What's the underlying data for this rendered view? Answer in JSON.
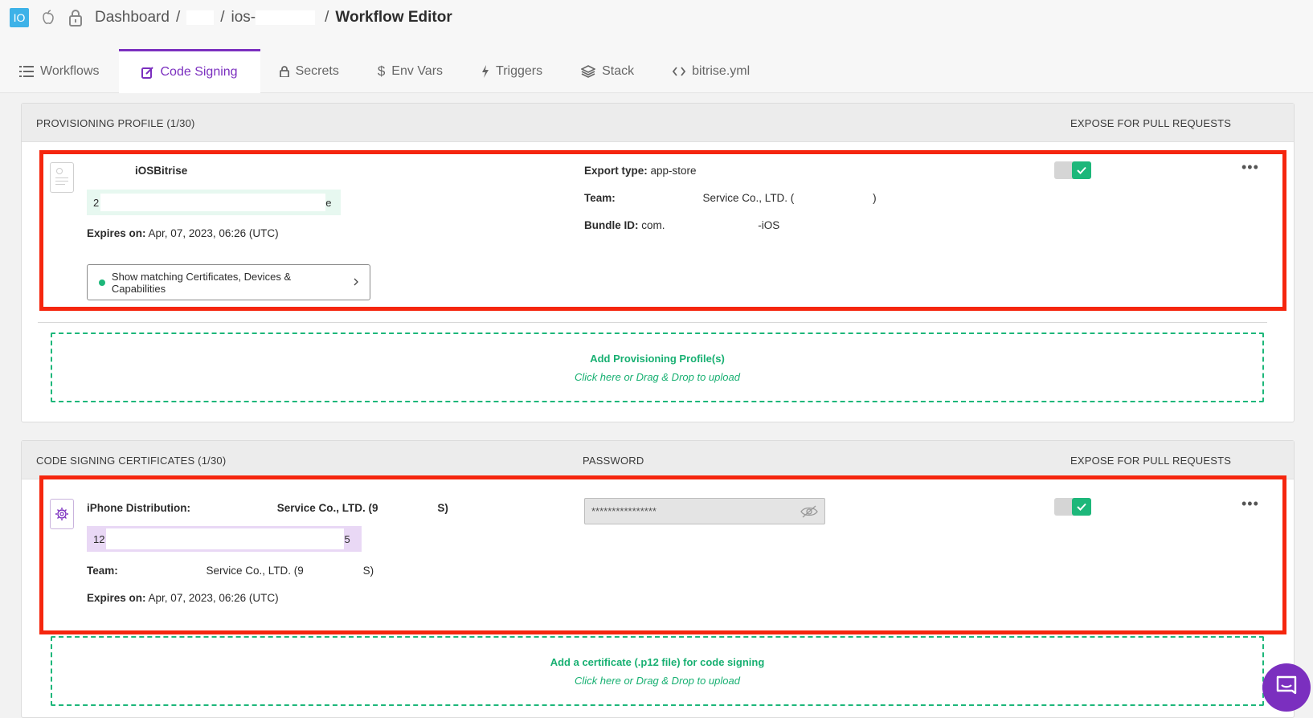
{
  "header": {
    "app_badge": "IO",
    "breadcrumb": {
      "dashboard": "Dashboard",
      "sep1": "/",
      "app_prefix": "ios-",
      "sep2": "/",
      "current": "Workflow Editor"
    }
  },
  "tabs": [
    {
      "label": "Workflows",
      "icon": "list-icon"
    },
    {
      "label": "Code Signing",
      "icon": "edit-icon",
      "active": true
    },
    {
      "label": "Secrets",
      "icon": "lock-icon"
    },
    {
      "label": "Env Vars",
      "icon": "dollar-icon"
    },
    {
      "label": "Triggers",
      "icon": "bolt-icon"
    },
    {
      "label": "Stack",
      "icon": "layers-icon"
    },
    {
      "label": "bitrise.yml",
      "icon": "code-icon"
    }
  ],
  "provisioning": {
    "title": "PROVISIONING PROFILE (1/30)",
    "expose_header": "EXPOSE FOR PULL REQUESTS",
    "profile": {
      "name": "iOSBitrise",
      "hash_start": "2",
      "hash_end": "e",
      "expires_label": "Expires on:",
      "expires_value": "Apr, 07, 2023, 06:26 (UTC)",
      "export_label": "Export type:",
      "export_value": "app-store",
      "team_label": "Team:",
      "team_value": "Service Co., LTD. (",
      "team_end": ")",
      "bundle_label": "Bundle ID:",
      "bundle_value": "com.",
      "bundle_end": "-iOS",
      "match_button": "Show matching Certificates, Devices & Capabilities",
      "expose_enabled": true
    },
    "dropzone": {
      "title": "Add Provisioning Profile(s)",
      "subtitle": "Click here or Drag & Drop to upload"
    }
  },
  "certificates": {
    "title": "CODE SIGNING CERTIFICATES (1/30)",
    "password_header": "PASSWORD",
    "expose_header": "EXPOSE FOR PULL REQUESTS",
    "cert": {
      "name_label": "iPhone Distribution:",
      "name_value": "Service Co., LTD. (9",
      "name_end": "S)",
      "hash_start": "12",
      "hash_end": "5",
      "team_label": "Team:",
      "team_value": "Service Co., LTD. (9",
      "team_end": "S)",
      "expires_label": "Expires on:",
      "expires_value": "Apr, 07, 2023, 06:26 (UTC)",
      "password_mask": "****************",
      "expose_enabled": true
    },
    "dropzone": {
      "title": "Add a certificate (.p12 file) for code signing",
      "subtitle": "Click here or Drag & Drop to upload"
    }
  },
  "colors": {
    "accent_purple": "#7b2fbf",
    "success_green": "#1db77a",
    "highlight_red": "#f5260e"
  }
}
